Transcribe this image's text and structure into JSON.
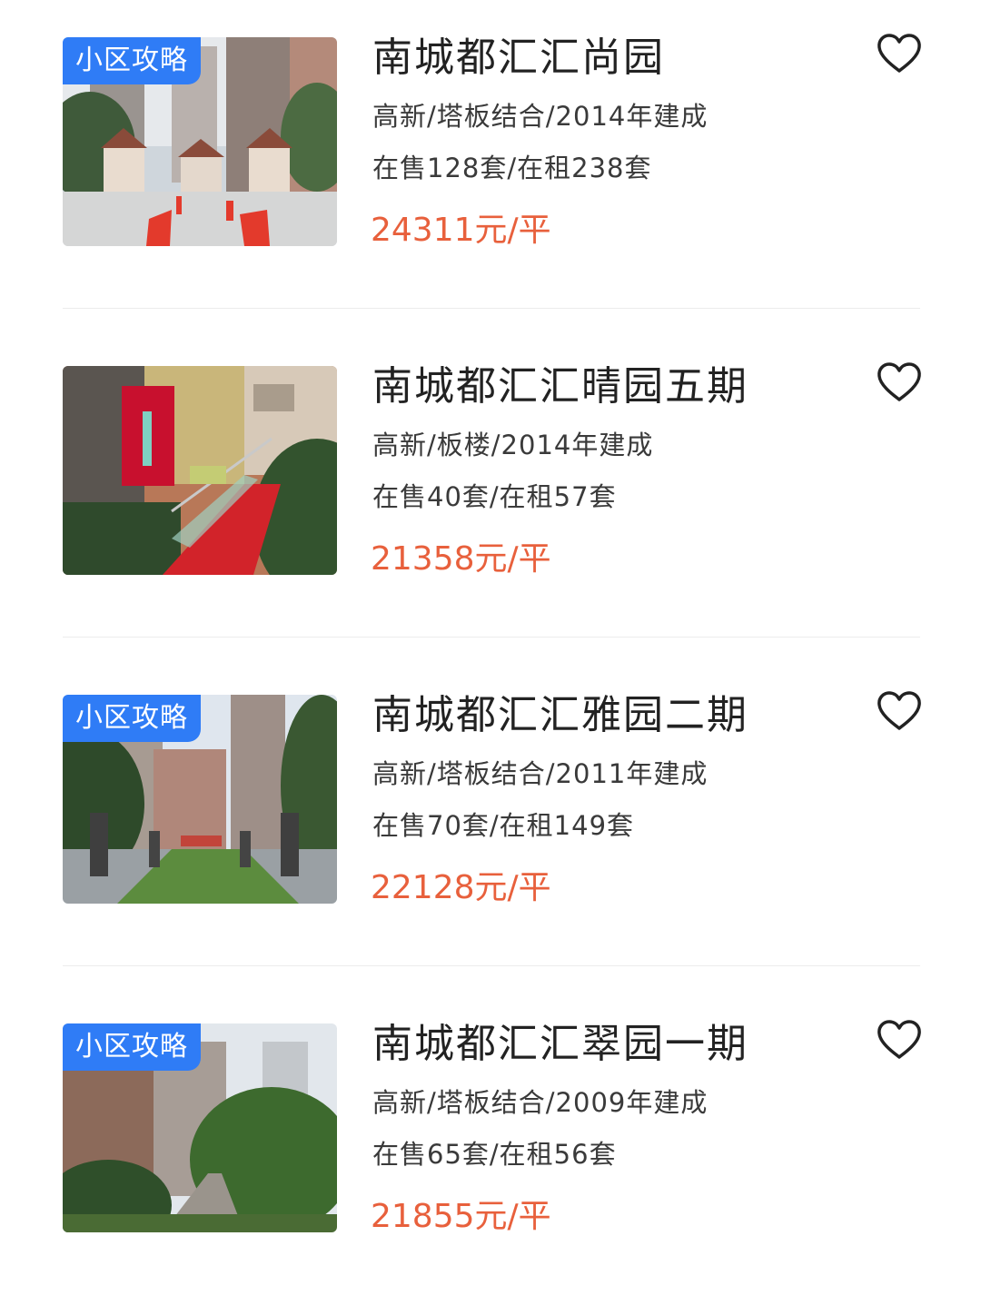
{
  "listings": [
    {
      "badge": "小区攻略",
      "title": "南城都汇汇尚园",
      "meta": "高新/塔板结合/2014年建成",
      "stock": "在售128套/在租238套",
      "price": "24311元/平"
    },
    {
      "badge": "",
      "title": "南城都汇汇晴园五期",
      "meta": "高新/板楼/2014年建成",
      "stock": "在售40套/在租57套",
      "price": "21358元/平"
    },
    {
      "badge": "小区攻略",
      "title": "南城都汇汇雅园二期",
      "meta": "高新/塔板结合/2011年建成",
      "stock": "在售70套/在租149套",
      "price": "22128元/平"
    },
    {
      "badge": "小区攻略",
      "title": "南城都汇汇翠园一期",
      "meta": "高新/塔板结合/2009年建成",
      "stock": "在售65套/在租56套",
      "price": "21855元/平"
    }
  ],
  "icons": {
    "favorite": "heart-outline-icon"
  },
  "colors": {
    "badge": "#2f7cf6",
    "price": "#e8603c"
  }
}
